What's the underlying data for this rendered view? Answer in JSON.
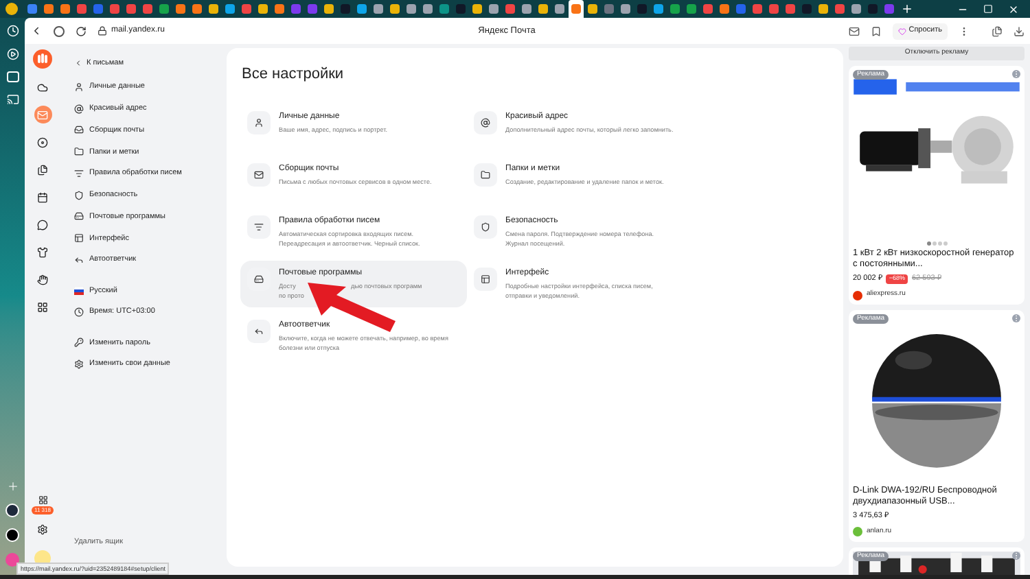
{
  "browser_tabs": [
    {
      "color": "#3b82f6",
      "selected": false
    },
    {
      "color": "#f97316",
      "selected": false
    },
    {
      "color": "#f97316",
      "selected": false
    },
    {
      "color": "#ef4444",
      "selected": false
    },
    {
      "color": "#2563eb",
      "selected": false
    },
    {
      "color": "#ef4444",
      "selected": false
    },
    {
      "color": "#ef4444",
      "selected": false
    },
    {
      "color": "#ef4444",
      "selected": false
    },
    {
      "color": "#16a34a",
      "selected": false
    },
    {
      "color": "#f97316",
      "selected": false
    },
    {
      "color": "#f97316",
      "selected": false
    },
    {
      "color": "#eab308",
      "selected": false
    },
    {
      "color": "#0ea5e9",
      "selected": false
    },
    {
      "color": "#ef4444",
      "selected": false
    },
    {
      "color": "#eab308",
      "selected": false
    },
    {
      "color": "#f97316",
      "selected": false
    },
    {
      "color": "#7c3aed",
      "selected": false
    },
    {
      "color": "#7c3aed",
      "selected": false
    },
    {
      "color": "#eab308",
      "selected": false
    },
    {
      "color": "#111827",
      "selected": false
    },
    {
      "color": "#0ea5e9",
      "selected": false
    },
    {
      "color": "#9ca3af",
      "selected": false
    },
    {
      "color": "#eab308",
      "selected": false
    },
    {
      "color": "#9ca3af",
      "selected": false
    },
    {
      "color": "#9ca3af",
      "selected": false
    },
    {
      "color": "#0d9488",
      "selected": false
    },
    {
      "color": "#111827",
      "selected": false
    },
    {
      "color": "#eab308",
      "selected": false
    },
    {
      "color": "#9ca3af",
      "selected": false
    },
    {
      "color": "#ef4444",
      "selected": false
    },
    {
      "color": "#9ca3af",
      "selected": false
    },
    {
      "color": "#eab308",
      "selected": false
    },
    {
      "color": "#9ca3af",
      "selected": false
    },
    {
      "color": "#f97316",
      "selected": true
    },
    {
      "color": "#eab308",
      "selected": false
    },
    {
      "color": "#6b7280",
      "selected": false
    },
    {
      "color": "#9ca3af",
      "selected": false
    },
    {
      "color": "#111827",
      "selected": false
    },
    {
      "color": "#0ea5e9",
      "selected": false
    },
    {
      "color": "#16a34a",
      "selected": false
    },
    {
      "color": "#16a34a",
      "selected": false
    },
    {
      "color": "#ef4444",
      "selected": false
    },
    {
      "color": "#f97316",
      "selected": false
    },
    {
      "color": "#2563eb",
      "selected": false
    },
    {
      "color": "#ef4444",
      "selected": false
    },
    {
      "color": "#ef4444",
      "selected": false
    },
    {
      "color": "#ef4444",
      "selected": false
    },
    {
      "color": "#111827",
      "selected": false
    },
    {
      "color": "#eab308",
      "selected": false
    },
    {
      "color": "#ef4444",
      "selected": false
    },
    {
      "color": "#9ca3af",
      "selected": false
    },
    {
      "color": "#111827",
      "selected": false
    },
    {
      "color": "#7c3aed",
      "selected": false
    }
  ],
  "address_bar": {
    "url": "mail.yandex.ru",
    "page_title": "Яндекс Почта",
    "ask_button": "Спросить"
  },
  "mail_rail": [
    {
      "kind": "cloud",
      "selected": false
    },
    {
      "kind": "mail",
      "selected": true
    },
    {
      "kind": "disk",
      "selected": false
    },
    {
      "kind": "files",
      "selected": false
    },
    {
      "kind": "calendar",
      "selected": false
    },
    {
      "kind": "chat",
      "selected": false
    },
    {
      "kind": "shirt",
      "selected": false
    },
    {
      "kind": "hand",
      "selected": false
    },
    {
      "kind": "apps",
      "selected": false
    }
  ],
  "rail_badge": "11 318",
  "settings_nav": {
    "back_link": "К письмам",
    "items": [
      {
        "kind": "user",
        "label": "Личные данные"
      },
      {
        "kind": "at",
        "label": "Красивый адрес"
      },
      {
        "kind": "inbox",
        "label": "Сборщик почты"
      },
      {
        "kind": "folder",
        "label": "Папки и метки"
      },
      {
        "kind": "rules",
        "label": "Правила обработки писем"
      },
      {
        "kind": "shield",
        "label": "Безопасность"
      },
      {
        "kind": "drive",
        "label": "Почтовые программы"
      },
      {
        "kind": "layout",
        "label": "Интерфейс"
      },
      {
        "kind": "reply",
        "label": "Автоответчик"
      }
    ],
    "locale": [
      {
        "kind": "flag",
        "label": "Русский"
      },
      {
        "kind": "clock",
        "label": "Время: UTC+03:00"
      }
    ],
    "account": [
      {
        "kind": "key",
        "label": "Изменить пароль"
      },
      {
        "kind": "settings",
        "label": "Изменить свои данные"
      }
    ],
    "delete_link": "Удалить ящик"
  },
  "main": {
    "title": "Все настройки",
    "cards": [
      {
        "kind": "user",
        "title": "Личные данные",
        "description": "Ваше имя, адрес, подпись и портрет.",
        "selected": false
      },
      {
        "kind": "at",
        "title": "Красивый адрес",
        "description": "Дополнительный адрес почты, который легко запомнить.",
        "selected": false
      },
      {
        "kind": "mail",
        "title": "Сборщик почты",
        "description": "Письма с любых почтовых сервисов в одном месте.",
        "selected": false
      },
      {
        "kind": "folder",
        "title": "Папки и метки",
        "description": "Создание, редактирование и удаление папок и меток.",
        "selected": false
      },
      {
        "kind": "rules",
        "title": "Правила обработки писем",
        "description": "Автоматическая сортировка входящих писем. Переадресация и автоответчик. Черный список.",
        "selected": false
      },
      {
        "kind": "shield",
        "title": "Безопасность",
        "description": "Смена пароля. Подтверждение номера телефона. Журнал посещений.",
        "selected": false
      },
      {
        "kind": "drive",
        "title": "Почтовые программы",
        "description_parts": [
          "Досту",
          "дью почтовых программ",
          "по прото"
        ],
        "selected": true
      },
      {
        "kind": "layout",
        "title": "Интерфейс",
        "description": "Подробные настройки интерфейса, списка писем, отправки и уведомлений.",
        "selected": false
      },
      {
        "kind": "reply",
        "title": "Автоответчик",
        "description": "Включите, когда не можете отвечать, например, во время болезни или отпуска",
        "selected": false
      }
    ]
  },
  "ads": {
    "disable_button": "Отключить рекламу",
    "cards": [
      {
        "label": "Реклама",
        "kind": "generator",
        "dots": [
          {
            "selected": true
          },
          {
            "selected": false
          },
          {
            "selected": false
          },
          {
            "selected": false
          }
        ],
        "title": "1 кВт 2 кВт низкоскоростной генератор с постоянными...",
        "price": "20 002 ₽",
        "discount": "−68%",
        "old_price": "62 593 ₽",
        "seller": {
          "name": "aliexpress.ru",
          "color": "#e62e04"
        }
      },
      {
        "label": "Реклама",
        "kind": "sphere",
        "title": "D-Link DWA-192/RU Беспроводной двухдиапазонный USB...",
        "price": "3 475,63 ₽",
        "seller": {
          "name": "anlan.ru",
          "color": "#6bbf3a"
        }
      },
      {
        "label": "Реклама",
        "kind": "board"
      }
    ]
  },
  "status_url": "https://mail.yandex.ru/?uid=2352489184#setup/client"
}
